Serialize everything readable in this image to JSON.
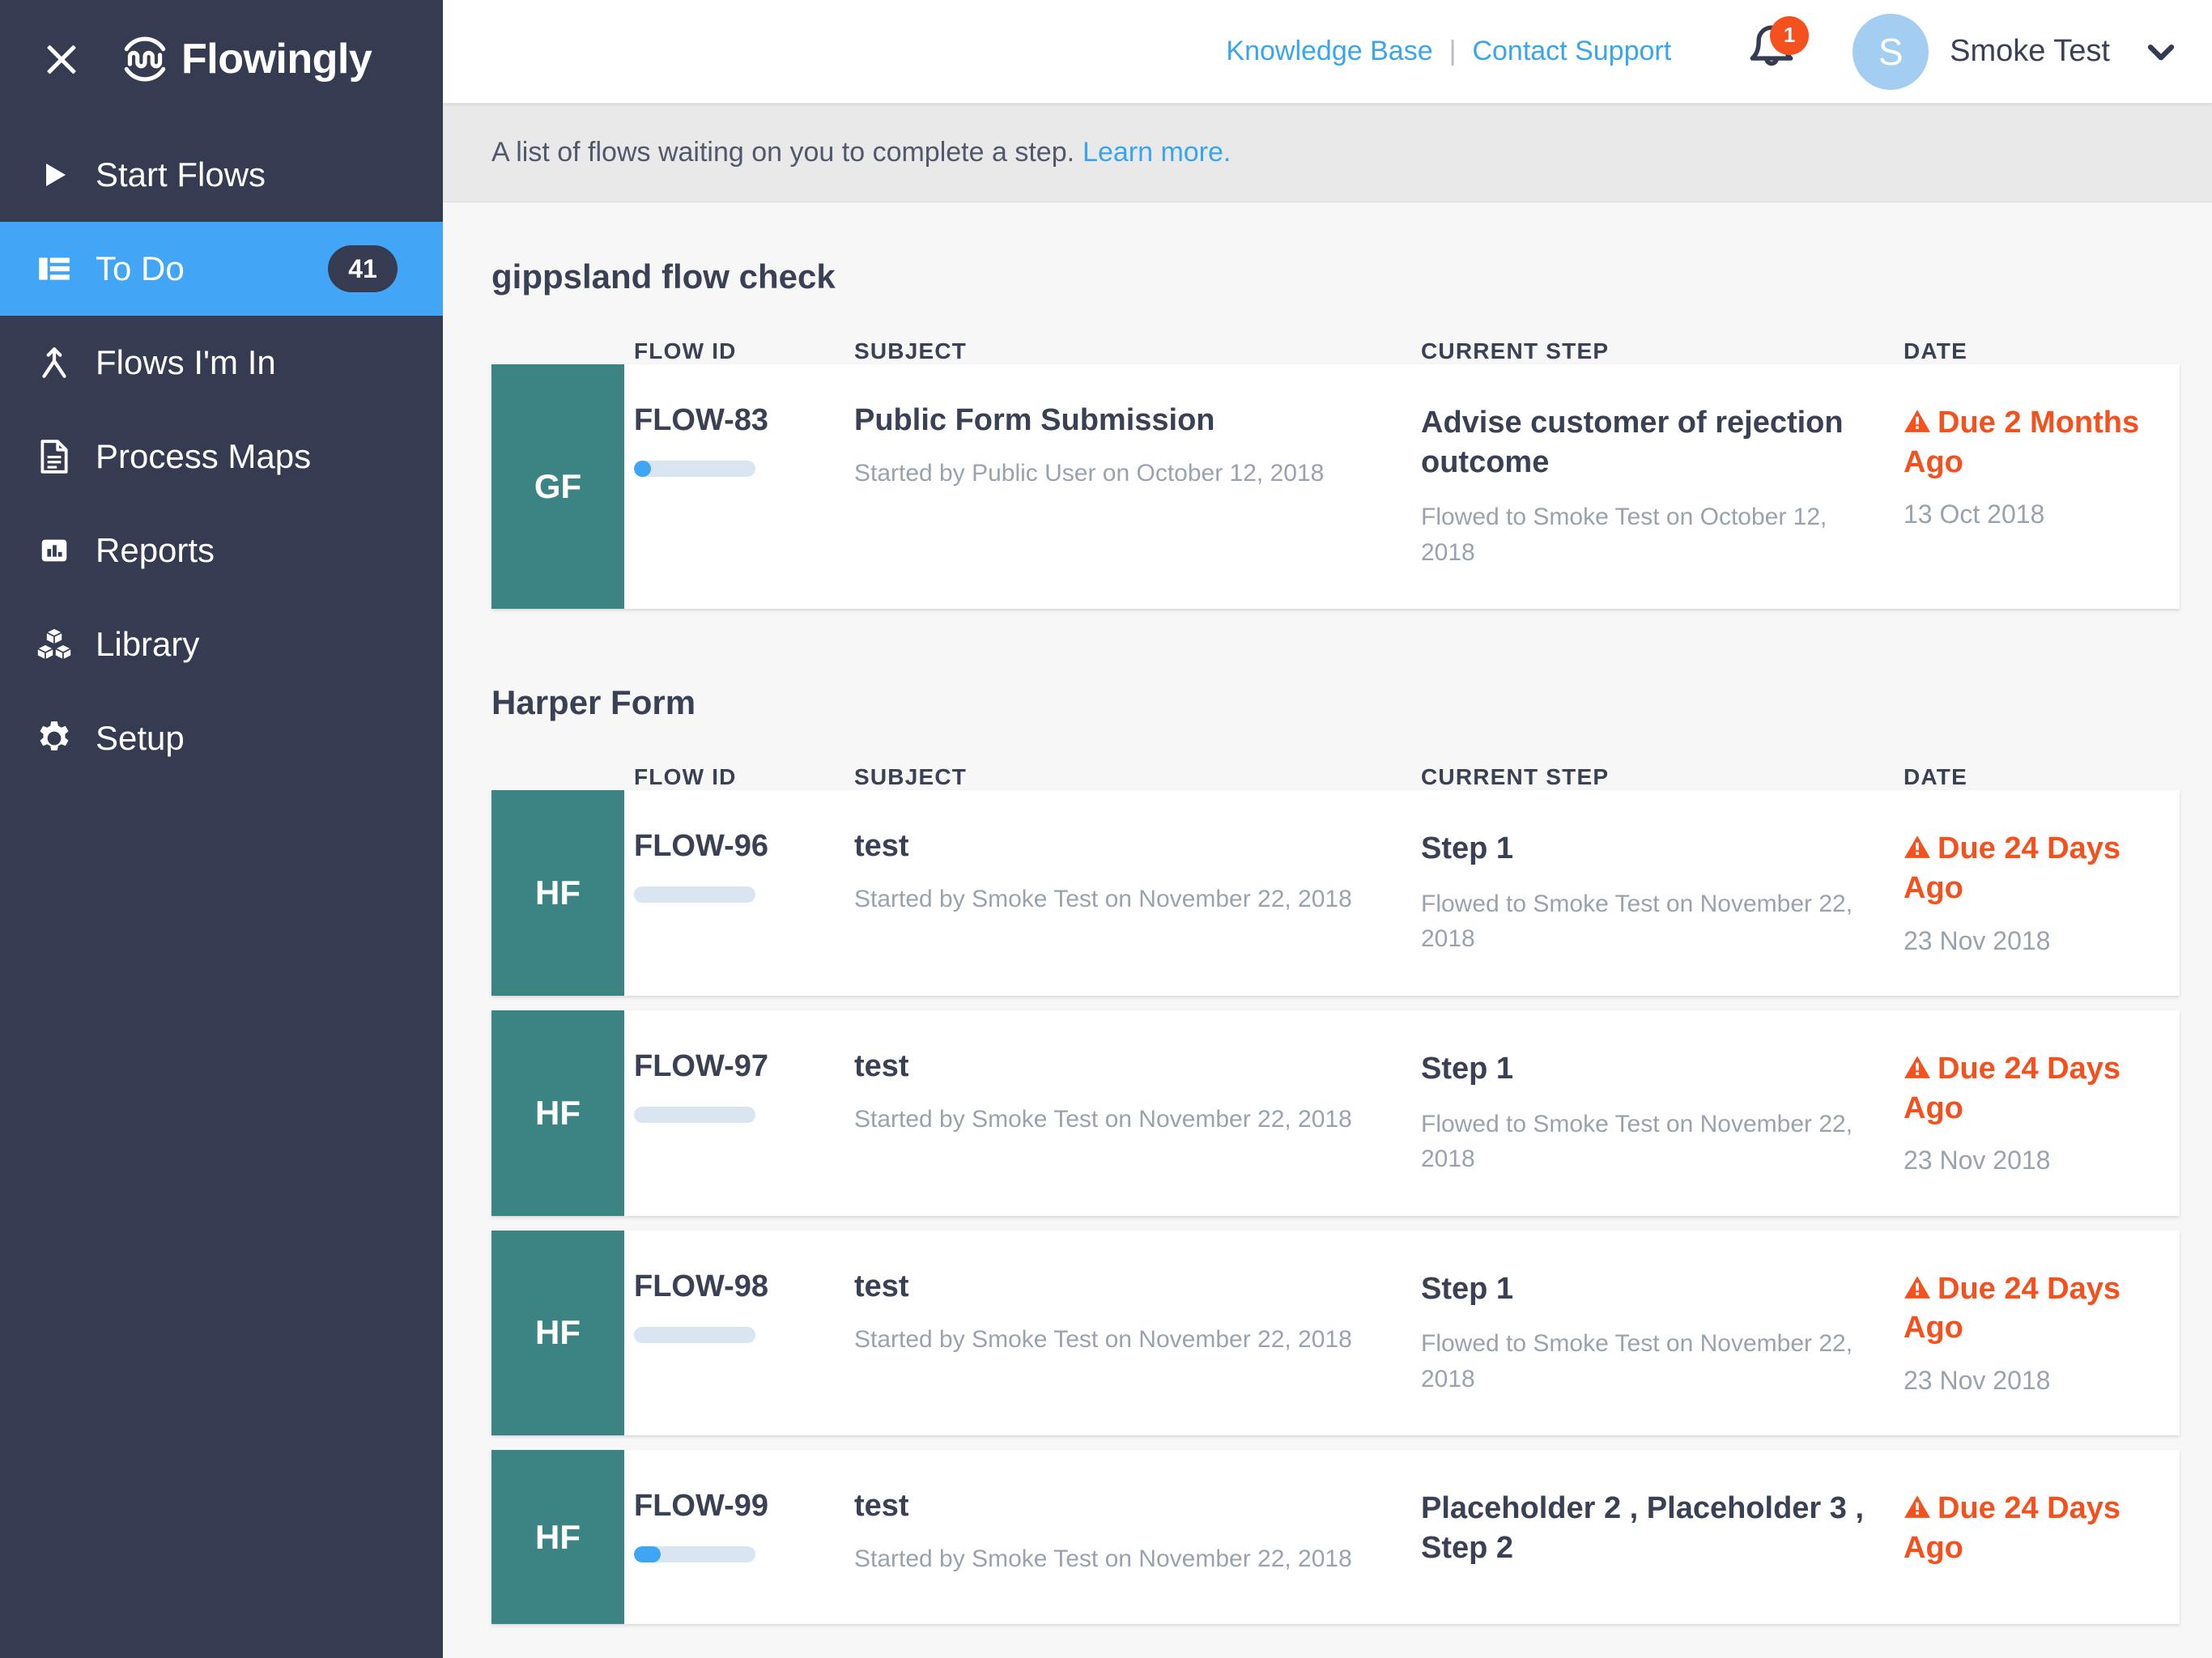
{
  "sidebar": {
    "close_label": "Close menu",
    "brand": "Flowingly",
    "items": [
      {
        "label": "Start Flows",
        "icon": "play-icon",
        "badge": null,
        "active": false
      },
      {
        "label": "To Do",
        "icon": "list-icon",
        "badge": "41",
        "active": true
      },
      {
        "label": "Flows I'm In",
        "icon": "merge-arrows-icon",
        "badge": null,
        "active": false
      },
      {
        "label": "Process Maps",
        "icon": "document-icon",
        "badge": null,
        "active": false
      },
      {
        "label": "Reports",
        "icon": "bar-chart-icon",
        "badge": null,
        "active": false
      },
      {
        "label": "Library",
        "icon": "cubes-icon",
        "badge": null,
        "active": false
      },
      {
        "label": "Setup",
        "icon": "gear-icon",
        "badge": null,
        "active": false
      }
    ]
  },
  "topbar": {
    "knowledge_base": "Knowledge Base",
    "separator": "|",
    "contact_support": "Contact Support",
    "bell_icon": "bell-icon",
    "notification_count": "1",
    "avatar_initial": "S",
    "user_name": "Smoke Test",
    "caret_icon": "chevron-down-icon"
  },
  "infobar": {
    "text": "A list of flows waiting on you to complete a step.",
    "link": "Learn more."
  },
  "columns": {
    "flow_id": "FLOW ID",
    "subject": "SUBJECT",
    "current_step": "CURRENT STEP",
    "date": "DATE"
  },
  "colors": {
    "sidebar_bg": "#353b50",
    "active_nav": "#42a5f5",
    "link_blue": "#39a5f0",
    "tag_teal": "#3c8484",
    "overdue_orange": "#f4511e",
    "avatar_blue": "#a4cdf2",
    "progress_track": "#d9e6f2",
    "progress_fill": "#41a5f5"
  },
  "groups": [
    {
      "title": "gippsland flow check",
      "rows": [
        {
          "tag": "GF",
          "flow_id": "FLOW-83",
          "progress_pct": 14,
          "subject": "Public Form Submission",
          "subject_sub": "Started by Public User on October 12, 2018",
          "step": "Advise customer of rejection outcome",
          "step_sub": "Flowed to Smoke Test on October 12, 2018",
          "due": "Due 2 Months Ago",
          "due_date": "13 Oct 2018"
        }
      ]
    },
    {
      "title": "Harper Form",
      "rows": [
        {
          "tag": "HF",
          "flow_id": "FLOW-96",
          "progress_pct": 0,
          "subject": "test",
          "subject_sub": "Started by Smoke Test on November 22, 2018",
          "step": "Step 1",
          "step_sub": "Flowed to Smoke Test on November 22, 2018",
          "due": "Due 24 Days Ago",
          "due_date": "23 Nov 2018"
        },
        {
          "tag": "HF",
          "flow_id": "FLOW-97",
          "progress_pct": 0,
          "subject": "test",
          "subject_sub": "Started by Smoke Test on November 22, 2018",
          "step": "Step 1",
          "step_sub": "Flowed to Smoke Test on November 22, 2018",
          "due": "Due 24 Days Ago",
          "due_date": "23 Nov 2018"
        },
        {
          "tag": "HF",
          "flow_id": "FLOW-98",
          "progress_pct": 0,
          "subject": "test",
          "subject_sub": "Started by Smoke Test on November 22, 2018",
          "step": "Step 1",
          "step_sub": "Flowed to Smoke Test on November 22, 2018",
          "due": "Due 24 Days Ago",
          "due_date": "23 Nov 2018"
        },
        {
          "tag": "HF",
          "flow_id": "FLOW-99",
          "progress_pct": 22,
          "subject": "test",
          "subject_sub": "Started by Smoke Test on November 22, 2018",
          "step": "Placeholder 2 , Placeholder 3 , Step 2",
          "step_sub": "",
          "due": "Due 24 Days Ago",
          "due_date": ""
        }
      ]
    }
  ]
}
